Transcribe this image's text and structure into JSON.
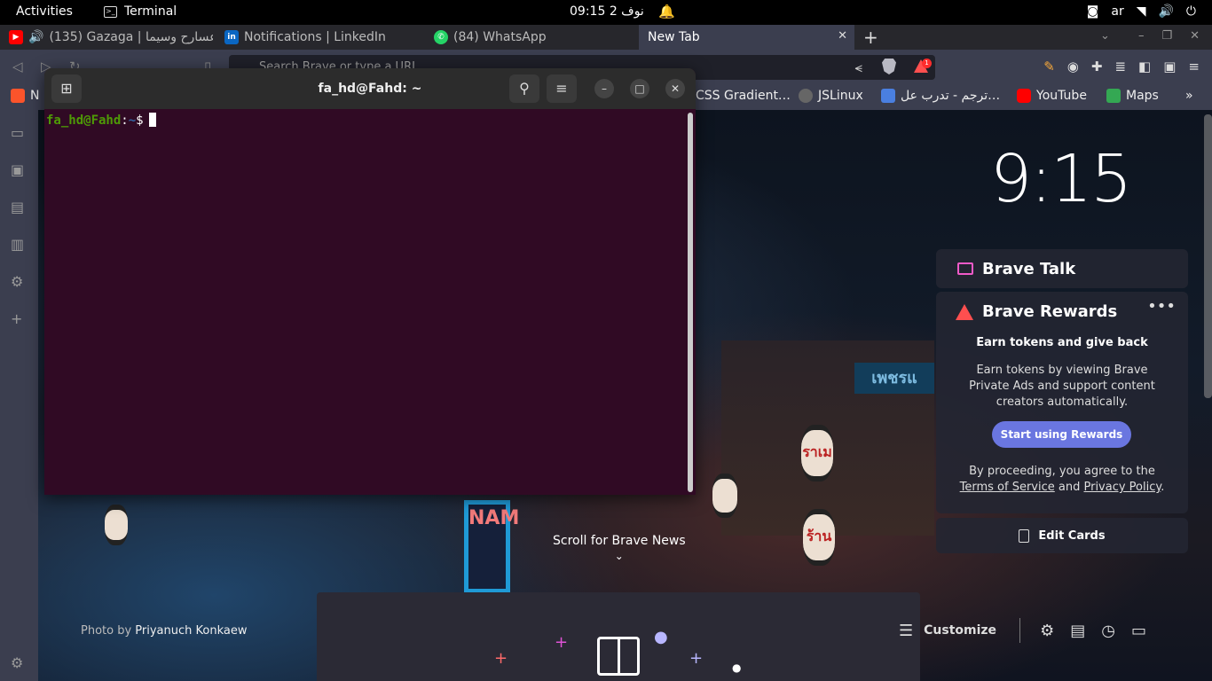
{
  "topbar": {
    "activities": "Activities",
    "app_name": "Terminal",
    "clock": "نوف 2  09:15",
    "lang": "ar"
  },
  "tabs": [
    {
      "title": "(135) Gazaga | عسارح وسيما",
      "favicon": "youtube-icon",
      "color": "#ff0000"
    },
    {
      "title": "Notifications | LinkedIn",
      "favicon": "linkedin-icon",
      "color": "#0a66c2"
    },
    {
      "title": "(84) WhatsApp",
      "favicon": "whatsapp-icon",
      "color": "#25d366"
    },
    {
      "title": "New Tab",
      "favicon": "",
      "color": ""
    }
  ],
  "urlbar": {
    "placeholder": "Search Brave or type a URL",
    "rewards_badge": "1"
  },
  "bookmarks": [
    {
      "label": "N",
      "favicon": "brave-icon",
      "color": "#fb542b"
    },
    {
      "label": "CSS Gradient…",
      "favicon": "",
      "color": ""
    },
    {
      "label": "JSLinux",
      "favicon": "globe-icon",
      "color": "#666"
    },
    {
      "label": "ترجم - تدرب عل…",
      "favicon": "translate-icon",
      "color": "#4a7fe0"
    },
    {
      "label": "YouTube",
      "favicon": "youtube-icon",
      "color": "#ff0000"
    },
    {
      "label": "Maps",
      "favicon": "maps-icon",
      "color": "#34a853"
    }
  ],
  "terminal": {
    "title": "fa_hd@Fahd: ~",
    "prompt_user": "fa_hd@Fahd",
    "prompt_sep": ":",
    "prompt_path": "~",
    "prompt_symbol": "$"
  },
  "newtab": {
    "clock": "9:15",
    "brave_talk": "Brave Talk",
    "rewards": {
      "title": "Brave Rewards",
      "more": "•••",
      "subtitle": "Earn tokens and give back",
      "description": "Earn tokens by viewing Brave Private Ads and support content creators automatically.",
      "button": "Start using Rewards",
      "legal_prefix": "By proceeding, you agree to the ",
      "terms": "Terms of Service",
      "legal_and": " and ",
      "privacy": "Privacy Policy",
      "legal_suffix": "."
    },
    "edit_cards": "Edit Cards",
    "scroll_news": "Scroll for Brave News",
    "photo_prefix": "Photo by ",
    "photo_author": "Priyanuch Konkaew",
    "customize": "Customize"
  },
  "background": {
    "sign_text": "เพชรแ",
    "neon_text": "NAM",
    "lantern_text": "ราเม",
    "lantern2_text": "ร้าน"
  }
}
